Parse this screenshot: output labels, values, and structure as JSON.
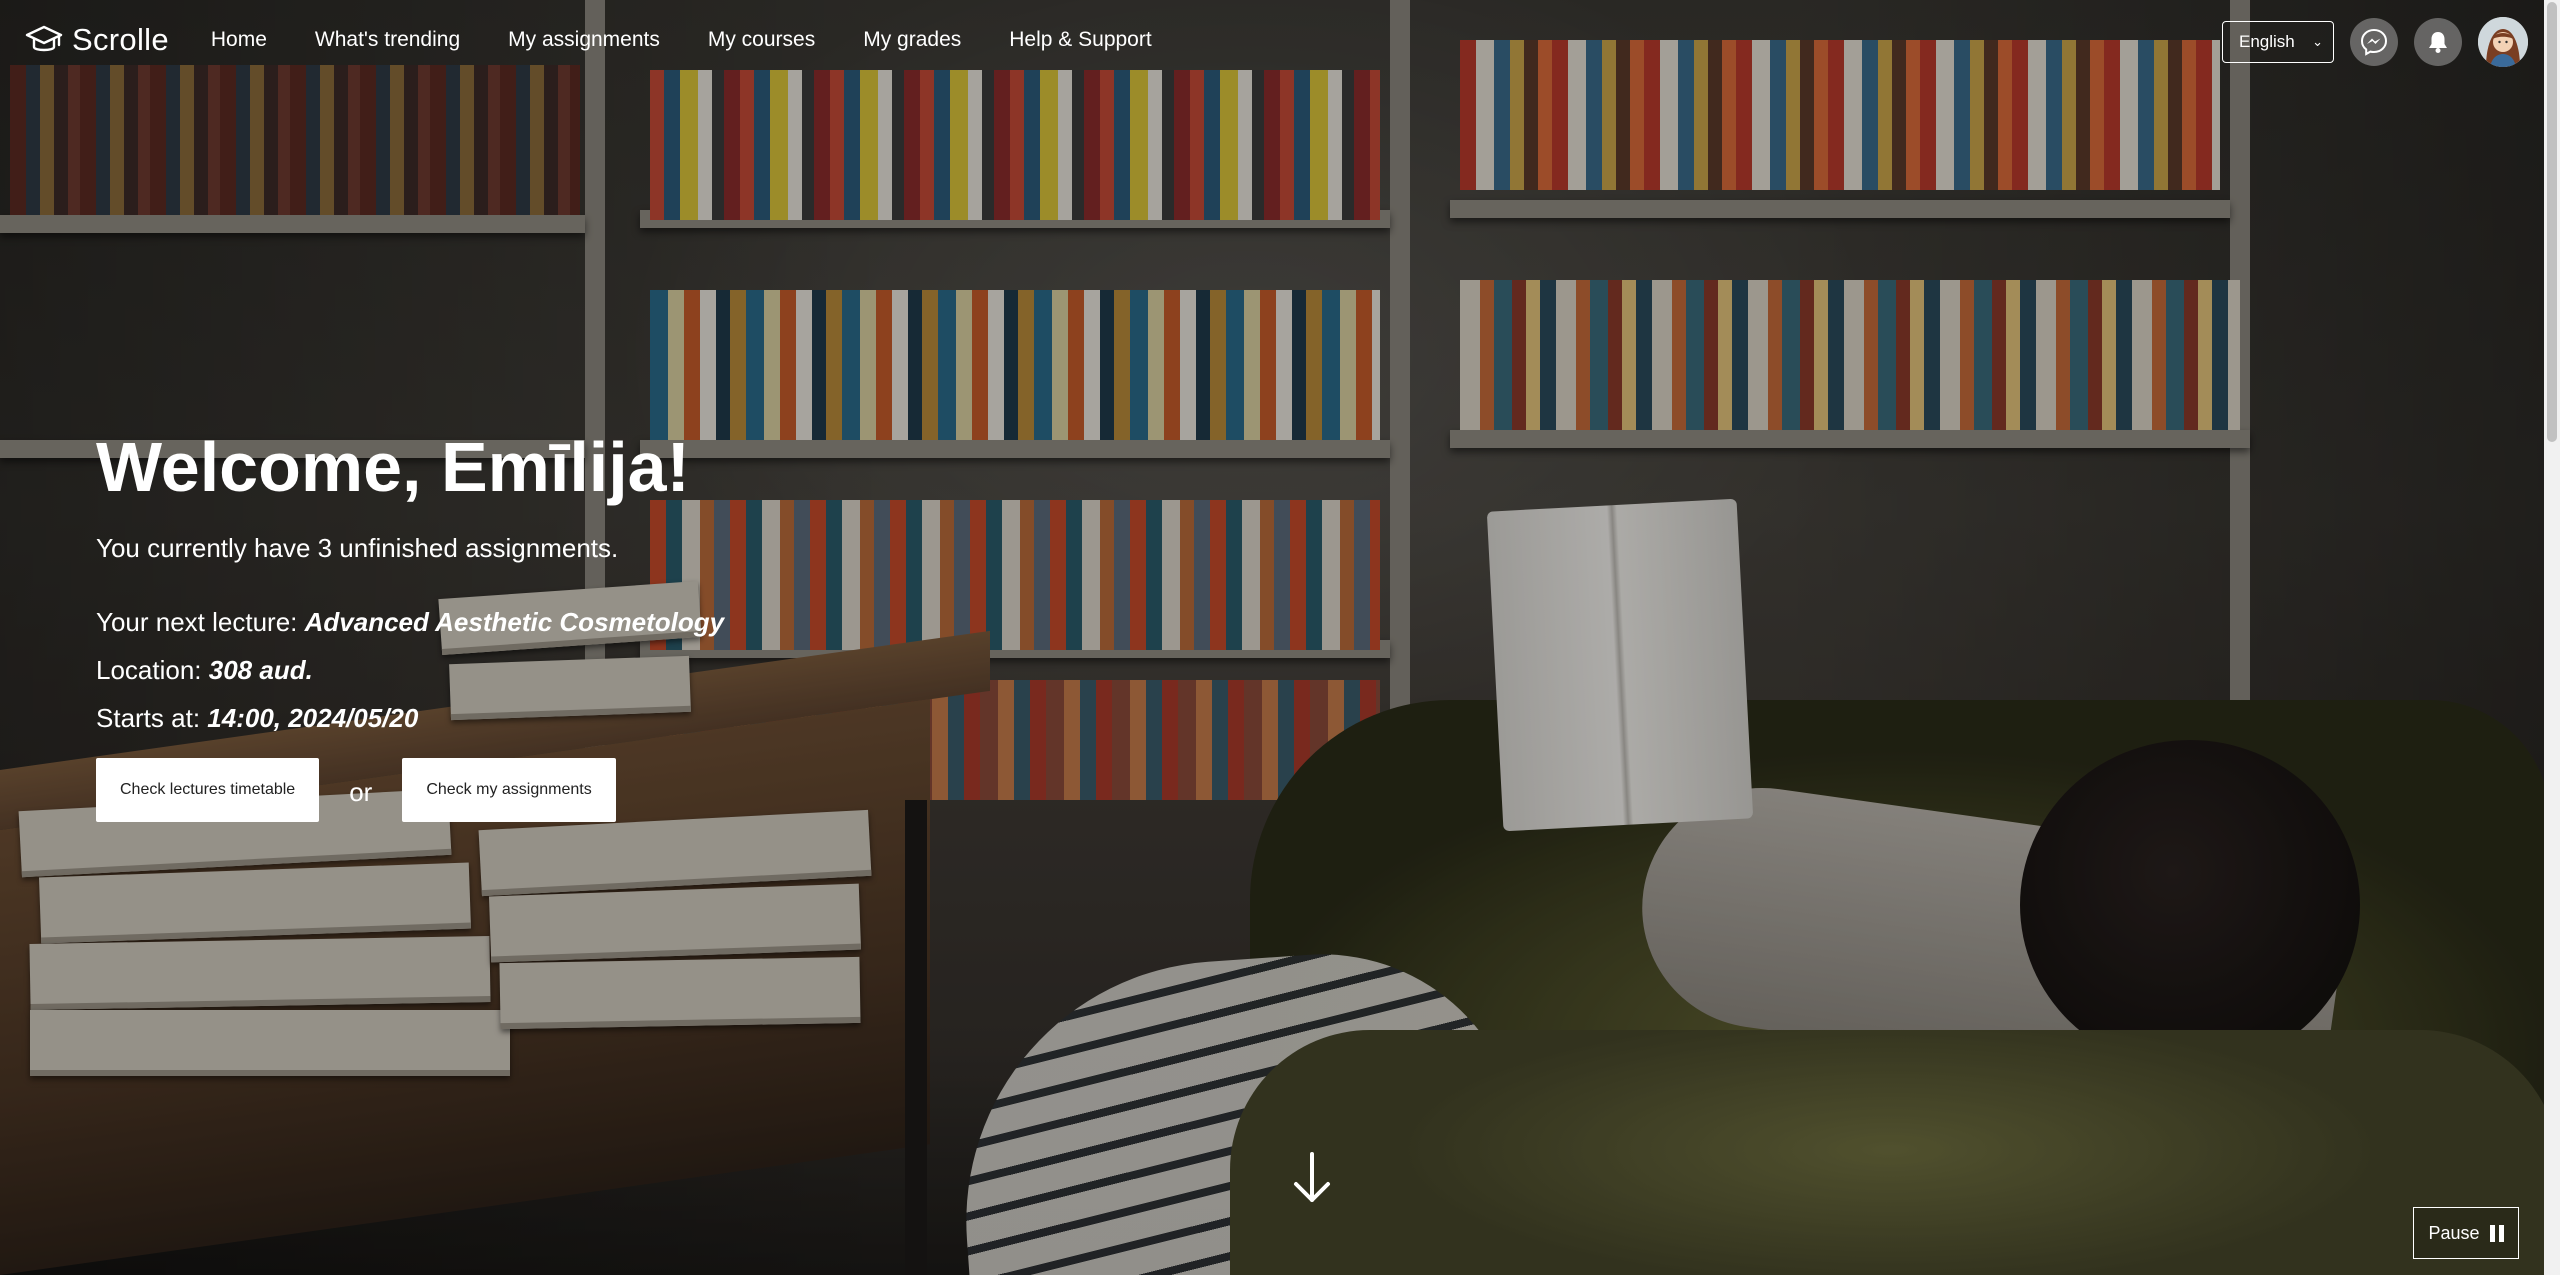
{
  "brand": {
    "name": "Scrolle",
    "icon": "graduation-cap-icon"
  },
  "nav": {
    "links": [
      "Home",
      "What's trending",
      "My assignments",
      "My courses",
      "My grades",
      "Help & Support"
    ]
  },
  "header_right": {
    "language": "English",
    "messenger_icon": "messenger-icon",
    "notifications_icon": "bell-icon",
    "avatar_icon": "user-avatar"
  },
  "hero": {
    "welcome": "Welcome, Emīlija!",
    "unfinished": "You currently have 3 unfinished assignments.",
    "next_lecture_label": "Your next lecture:",
    "next_lecture_value": "Advanced Aesthetic Cosmetology",
    "location_label": "Location:",
    "location_value": "308 aud.",
    "starts_label": "Starts at:",
    "starts_value": "14:00, 2024/05/20",
    "button_timetable": "Check lectures timetable",
    "or_text": "or",
    "button_assignments": "Check my assignments"
  },
  "controls": {
    "pause_label": "Pause",
    "scroll_icon": "arrow-down-icon"
  },
  "colors": {
    "text": "#ffffff",
    "button_bg": "#ffffff",
    "button_text": "#222222"
  }
}
